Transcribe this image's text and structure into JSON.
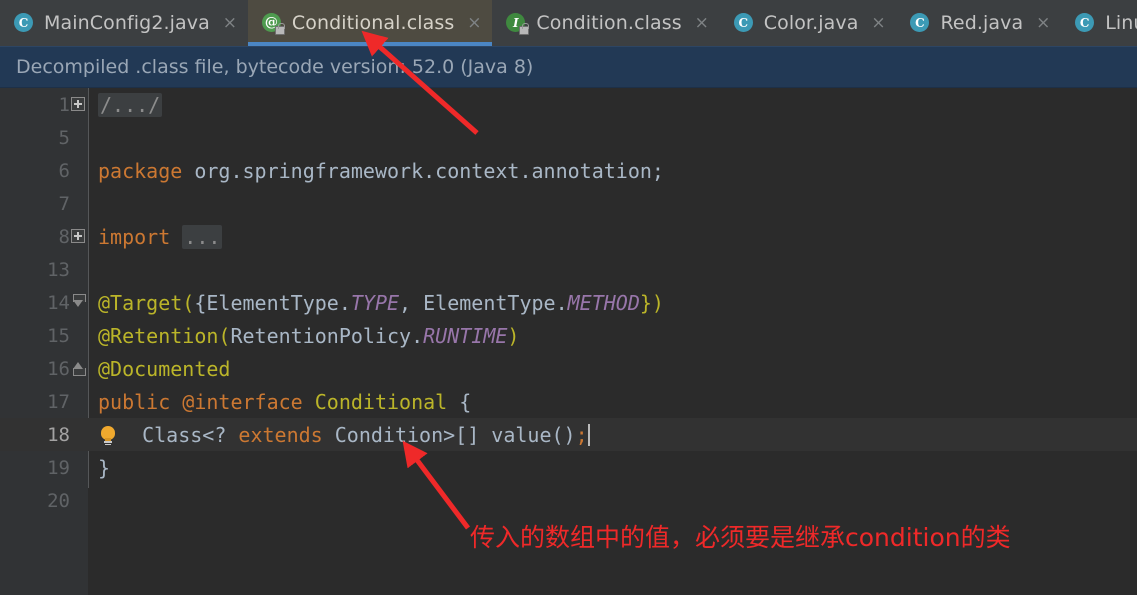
{
  "window": {
    "title": "Conditional.class"
  },
  "tabs": [
    {
      "label": "MainConfig2.java",
      "icon": "java-class-icon",
      "icon_kind": "cls",
      "locked": false,
      "active": false,
      "closable": true
    },
    {
      "label": "Conditional.class",
      "icon": "annotation-type-icon",
      "icon_kind": "anno",
      "icon_glyph": "@",
      "locked": true,
      "active": true,
      "closable": true
    },
    {
      "label": "Condition.class",
      "icon": "interface-icon",
      "icon_kind": "iface",
      "icon_glyph": "I",
      "locked": true,
      "active": false,
      "closable": true
    },
    {
      "label": "Color.java",
      "icon": "java-class-icon",
      "icon_kind": "cls",
      "icon_glyph": "C",
      "locked": false,
      "active": false,
      "closable": true
    },
    {
      "label": "Red.java",
      "icon": "java-class-icon",
      "icon_kind": "cls",
      "icon_glyph": "C",
      "locked": false,
      "active": false,
      "closable": true
    },
    {
      "label": "LinuxCondition.j",
      "icon": "java-class-icon",
      "icon_kind": "cls",
      "icon_glyph": "C",
      "locked": false,
      "active": false,
      "closable": true
    }
  ],
  "tab_icon_glyphs": {
    "cls": "C",
    "anno": "@",
    "iface": "I"
  },
  "close_glyph": "×",
  "notification": {
    "text": "Decompiled .class file, bytecode version: 52.0 (Java 8)"
  },
  "editor": {
    "current_line": 18,
    "lines": [
      {
        "no": "1",
        "fold": "plus",
        "current": false
      },
      {
        "no": "5",
        "fold": "none",
        "current": false
      },
      {
        "no": "6",
        "fold": "none",
        "current": false
      },
      {
        "no": "7",
        "fold": "none",
        "current": false
      },
      {
        "no": "8",
        "fold": "plus",
        "current": false
      },
      {
        "no": "13",
        "fold": "none",
        "current": false
      },
      {
        "no": "14",
        "fold": "open",
        "current": false
      },
      {
        "no": "15",
        "fold": "none",
        "current": false
      },
      {
        "no": "16",
        "fold": "close",
        "current": false
      },
      {
        "no": "17",
        "fold": "none",
        "current": false
      },
      {
        "no": "18",
        "fold": "none",
        "current": true
      },
      {
        "no": "19",
        "fold": "none",
        "current": false
      },
      {
        "no": "20",
        "fold": "none",
        "current": false
      }
    ],
    "code": {
      "l1_folded_comment": "/.../",
      "l6_kw_package": "package",
      "l6_pkg_name": " org.springframework.context.annotation;",
      "l8_kw_import": "import",
      "l8_folded": "...",
      "l14_a": "@Target(",
      "l14_b": "{ElementType.",
      "l14_c": "TYPE",
      "l14_d": ", ElementType.",
      "l14_e": "METHOD",
      "l14_f": "})",
      "l15_a": "@Retention(",
      "l15_b": "RetentionPolicy.",
      "l15_c": "RUNTIME",
      "l15_d": ")",
      "l16": "@Documented",
      "l17_kw_public": "public ",
      "l17_kw_interface": "@interface ",
      "l17_name": "Conditional",
      "l17_brace": " {",
      "l18_a": "Class<? ",
      "l18_b": "extends ",
      "l18_c": "Condition>[] ",
      "l18_d": "value()",
      "l18_e": ";",
      "l19": "}"
    }
  },
  "annotations": {
    "chinese_note": "传入的数组中的值，必须要是继承condition的类",
    "arrow_color": "#ef2929"
  },
  "colors": {
    "editor_bg": "#2b2b2b",
    "gutter_bg": "#313335",
    "tabbar_bg": "#3c3f41",
    "active_tab_bg": "#4e4b41",
    "active_tab_underline": "#4b86c4",
    "notification_bg": "#223955",
    "current_line_bg": "#323232",
    "keyword": "#cc7832",
    "annotation": "#bbb529",
    "constant": "#9876aa",
    "text": "#a9b7c6",
    "red_marker": "#ef2929"
  }
}
